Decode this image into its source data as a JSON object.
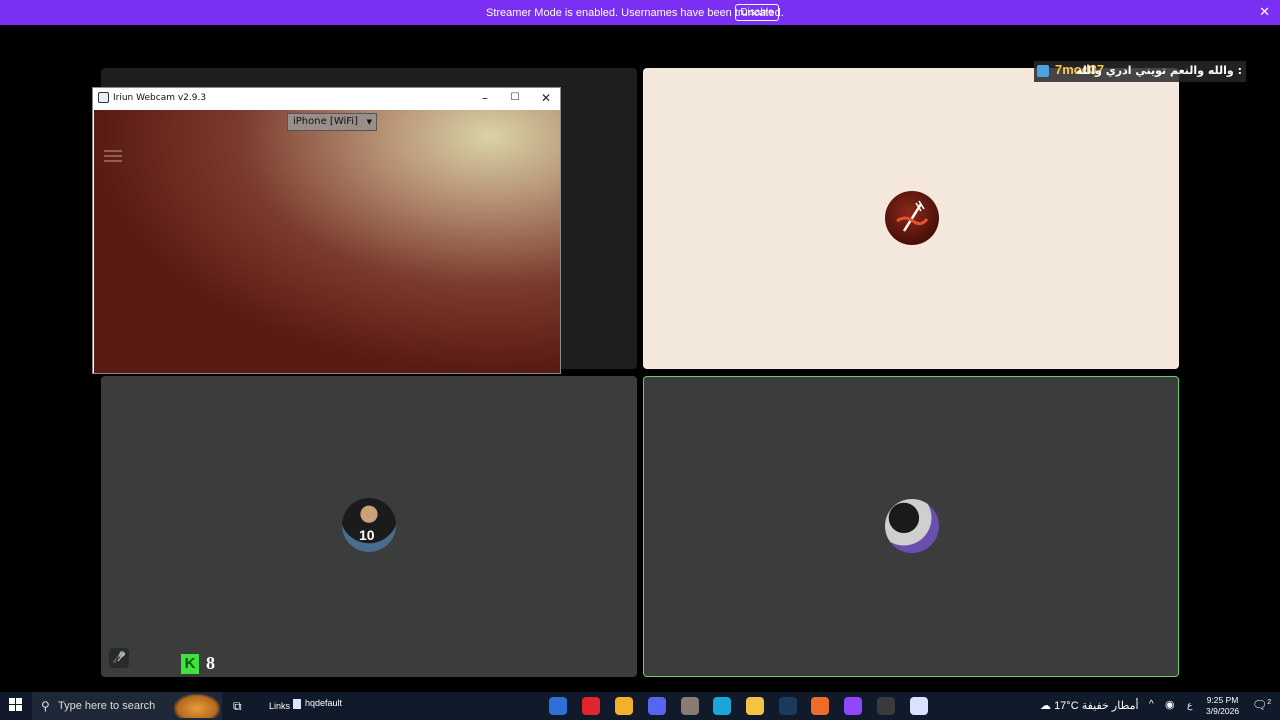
{
  "banner": {
    "message": "Streamer Mode is enabled. Usernames have been truncated.",
    "disable_label": "Disable",
    "close_glyph": "✕"
  },
  "chat": {
    "username": "7mod37",
    "message": "والله والنعم تويني ادري والله :"
  },
  "iriun": {
    "title": "Iriun Webcam v2.9.3",
    "device": "iPhone [WiFi]",
    "minimize_glyph": "–",
    "maximize_glyph": "☐",
    "close_glyph": "✕"
  },
  "tiles": {
    "bottom_left": {
      "avatar_text": "10",
      "mute_glyph": "🎤̸",
      "badge_letter": "K",
      "badge_count": "8"
    }
  },
  "taskbar": {
    "search_placeholder": "Type here to search",
    "links_label": "Links",
    "pinned_file": "hqdefault",
    "weather_temp": "17°C",
    "weather_desc": "أمطار خفيفة",
    "lang": "ع",
    "time": "9:25 PM",
    "date": "3/9/2026",
    "notification_count": "2",
    "apps": [
      {
        "name": "outlook-icon",
        "color": "#2e6fd8"
      },
      {
        "name": "acrobat-icon",
        "color": "#e0252c"
      },
      {
        "name": "messenger-icon",
        "color": "#f2b02b"
      },
      {
        "name": "discord-icon",
        "color": "#5865f2"
      },
      {
        "name": "photo-icon",
        "color": "#8a7a74"
      },
      {
        "name": "edge-icon",
        "color": "#1aa6d6"
      },
      {
        "name": "file-explorer-icon",
        "color": "#f5c342"
      },
      {
        "name": "steam-icon",
        "color": "#1b3a5c"
      },
      {
        "name": "orange-app-icon",
        "color": "#f06a28"
      },
      {
        "name": "twitch-icon",
        "color": "#9146ff"
      },
      {
        "name": "obs-icon",
        "color": "#3a3a3a"
      },
      {
        "name": "iriun-icon",
        "color": "#d7e3ff"
      }
    ]
  }
}
